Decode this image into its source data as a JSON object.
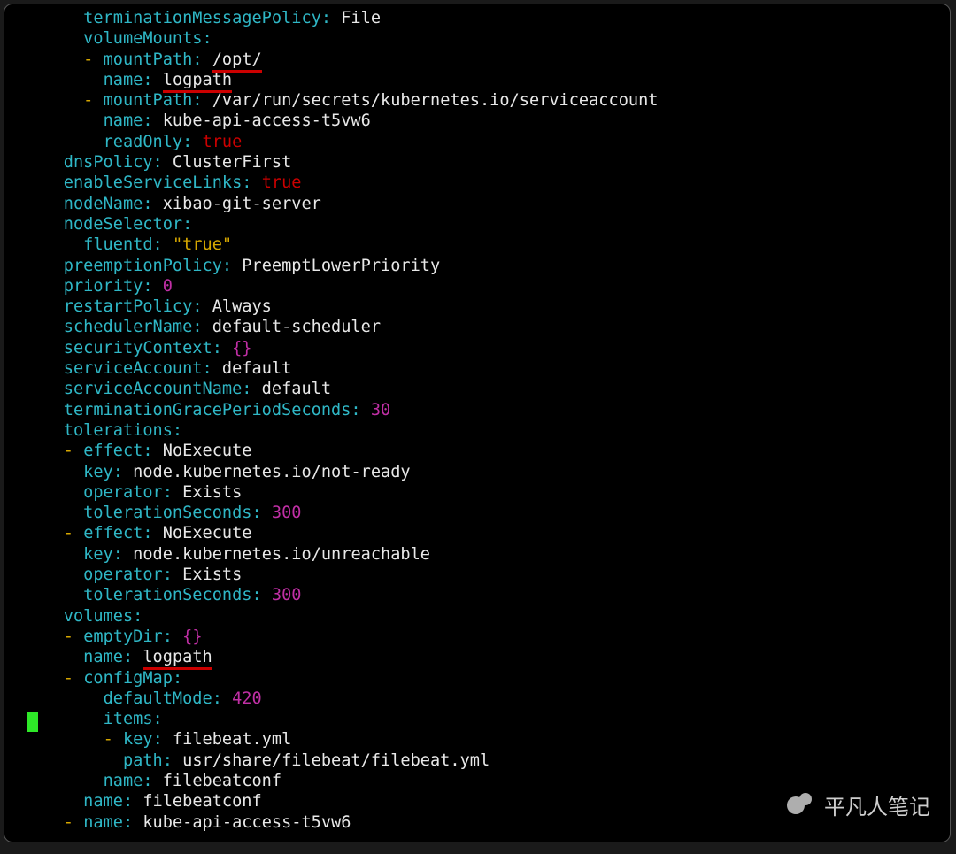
{
  "watermark": "平凡人笔记",
  "lines": [
    {
      "indent": 6,
      "tokens": [
        {
          "c": "k",
          "t": "terminationMessagePolicy"
        },
        {
          "c": "k",
          "t": ":"
        },
        {
          "c": "v",
          "t": " File"
        }
      ]
    },
    {
      "indent": 6,
      "tokens": [
        {
          "c": "k",
          "t": "volumeMounts"
        },
        {
          "c": "k",
          "t": ":"
        }
      ]
    },
    {
      "indent": 6,
      "tokens": [
        {
          "c": "d",
          "t": "-"
        },
        {
          "c": "v",
          "t": " "
        },
        {
          "c": "k",
          "t": "mountPath"
        },
        {
          "c": "k",
          "t": ":"
        },
        {
          "c": "v",
          "t": " "
        },
        {
          "c": "v",
          "t": "/opt/",
          "u": true
        }
      ]
    },
    {
      "indent": 8,
      "tokens": [
        {
          "c": "k",
          "t": "name"
        },
        {
          "c": "k",
          "t": ":"
        },
        {
          "c": "v",
          "t": " "
        },
        {
          "c": "v",
          "t": "logpath",
          "u": true
        }
      ]
    },
    {
      "indent": 6,
      "tokens": [
        {
          "c": "d",
          "t": "-"
        },
        {
          "c": "v",
          "t": " "
        },
        {
          "c": "k",
          "t": "mountPath"
        },
        {
          "c": "k",
          "t": ":"
        },
        {
          "c": "v",
          "t": " /var/run/secrets/kubernetes.io/serviceaccount"
        }
      ]
    },
    {
      "indent": 8,
      "tokens": [
        {
          "c": "k",
          "t": "name"
        },
        {
          "c": "k",
          "t": ":"
        },
        {
          "c": "v",
          "t": " kube-api-access-t5vw6"
        }
      ]
    },
    {
      "indent": 8,
      "tokens": [
        {
          "c": "k",
          "t": "readOnly"
        },
        {
          "c": "k",
          "t": ":"
        },
        {
          "c": "v",
          "t": " "
        },
        {
          "c": "t",
          "t": "true"
        }
      ]
    },
    {
      "indent": 4,
      "tokens": [
        {
          "c": "k",
          "t": "dnsPolicy"
        },
        {
          "c": "k",
          "t": ":"
        },
        {
          "c": "v",
          "t": " ClusterFirst"
        }
      ]
    },
    {
      "indent": 4,
      "tokens": [
        {
          "c": "k",
          "t": "enableServiceLinks"
        },
        {
          "c": "k",
          "t": ":"
        },
        {
          "c": "v",
          "t": " "
        },
        {
          "c": "t",
          "t": "true"
        }
      ]
    },
    {
      "indent": 4,
      "tokens": [
        {
          "c": "k",
          "t": "nodeName"
        },
        {
          "c": "k",
          "t": ":"
        },
        {
          "c": "v",
          "t": " xibao-git-server"
        }
      ]
    },
    {
      "indent": 4,
      "tokens": [
        {
          "c": "k",
          "t": "nodeSelector"
        },
        {
          "c": "k",
          "t": ":"
        }
      ]
    },
    {
      "indent": 6,
      "tokens": [
        {
          "c": "k",
          "t": "fluentd"
        },
        {
          "c": "k",
          "t": ":"
        },
        {
          "c": "v",
          "t": " "
        },
        {
          "c": "s",
          "t": "\"true\""
        }
      ]
    },
    {
      "indent": 4,
      "tokens": [
        {
          "c": "k",
          "t": "preemptionPolicy"
        },
        {
          "c": "k",
          "t": ":"
        },
        {
          "c": "v",
          "t": " PreemptLowerPriority"
        }
      ]
    },
    {
      "indent": 4,
      "tokens": [
        {
          "c": "k",
          "t": "priority"
        },
        {
          "c": "k",
          "t": ":"
        },
        {
          "c": "v",
          "t": " "
        },
        {
          "c": "n",
          "t": "0"
        }
      ]
    },
    {
      "indent": 4,
      "tokens": [
        {
          "c": "k",
          "t": "restartPolicy"
        },
        {
          "c": "k",
          "t": ":"
        },
        {
          "c": "v",
          "t": " Always"
        }
      ]
    },
    {
      "indent": 4,
      "tokens": [
        {
          "c": "k",
          "t": "schedulerName"
        },
        {
          "c": "k",
          "t": ":"
        },
        {
          "c": "v",
          "t": " default-scheduler"
        }
      ]
    },
    {
      "indent": 4,
      "tokens": [
        {
          "c": "k",
          "t": "securityContext"
        },
        {
          "c": "k",
          "t": ":"
        },
        {
          "c": "v",
          "t": " "
        },
        {
          "c": "n",
          "t": "{}"
        }
      ]
    },
    {
      "indent": 4,
      "tokens": [
        {
          "c": "k",
          "t": "serviceAccount"
        },
        {
          "c": "k",
          "t": ":"
        },
        {
          "c": "v",
          "t": " default"
        }
      ]
    },
    {
      "indent": 4,
      "tokens": [
        {
          "c": "k",
          "t": "serviceAccountName"
        },
        {
          "c": "k",
          "t": ":"
        },
        {
          "c": "v",
          "t": " default"
        }
      ]
    },
    {
      "indent": 4,
      "tokens": [
        {
          "c": "k",
          "t": "terminationGracePeriodSeconds"
        },
        {
          "c": "k",
          "t": ":"
        },
        {
          "c": "v",
          "t": " "
        },
        {
          "c": "n",
          "t": "30"
        }
      ]
    },
    {
      "indent": 4,
      "tokens": [
        {
          "c": "k",
          "t": "tolerations"
        },
        {
          "c": "k",
          "t": ":"
        }
      ]
    },
    {
      "indent": 4,
      "tokens": [
        {
          "c": "d",
          "t": "-"
        },
        {
          "c": "v",
          "t": " "
        },
        {
          "c": "k",
          "t": "effect"
        },
        {
          "c": "k",
          "t": ":"
        },
        {
          "c": "v",
          "t": " NoExecute"
        }
      ]
    },
    {
      "indent": 6,
      "tokens": [
        {
          "c": "k",
          "t": "key"
        },
        {
          "c": "k",
          "t": ":"
        },
        {
          "c": "v",
          "t": " node.kubernetes.io/not-ready"
        }
      ]
    },
    {
      "indent": 6,
      "tokens": [
        {
          "c": "k",
          "t": "operator"
        },
        {
          "c": "k",
          "t": ":"
        },
        {
          "c": "v",
          "t": " Exists"
        }
      ]
    },
    {
      "indent": 6,
      "tokens": [
        {
          "c": "k",
          "t": "tolerationSeconds"
        },
        {
          "c": "k",
          "t": ":"
        },
        {
          "c": "v",
          "t": " "
        },
        {
          "c": "n",
          "t": "300"
        }
      ]
    },
    {
      "indent": 4,
      "tokens": [
        {
          "c": "d",
          "t": "-"
        },
        {
          "c": "v",
          "t": " "
        },
        {
          "c": "k",
          "t": "effect"
        },
        {
          "c": "k",
          "t": ":"
        },
        {
          "c": "v",
          "t": " NoExecute"
        }
      ]
    },
    {
      "indent": 6,
      "tokens": [
        {
          "c": "k",
          "t": "key"
        },
        {
          "c": "k",
          "t": ":"
        },
        {
          "c": "v",
          "t": " node.kubernetes.io/unreachable"
        }
      ]
    },
    {
      "indent": 6,
      "tokens": [
        {
          "c": "k",
          "t": "operator"
        },
        {
          "c": "k",
          "t": ":"
        },
        {
          "c": "v",
          "t": " Exists"
        }
      ]
    },
    {
      "indent": 6,
      "tokens": [
        {
          "c": "k",
          "t": "tolerationSeconds"
        },
        {
          "c": "k",
          "t": ":"
        },
        {
          "c": "v",
          "t": " "
        },
        {
          "c": "n",
          "t": "300"
        }
      ]
    },
    {
      "indent": 4,
      "tokens": [
        {
          "c": "k",
          "t": "volumes"
        },
        {
          "c": "k",
          "t": ":"
        }
      ]
    },
    {
      "indent": 4,
      "tokens": [
        {
          "c": "d",
          "t": "-"
        },
        {
          "c": "v",
          "t": " "
        },
        {
          "c": "k",
          "t": "emptyDir"
        },
        {
          "c": "k",
          "t": ":"
        },
        {
          "c": "v",
          "t": " "
        },
        {
          "c": "n",
          "t": "{}"
        }
      ]
    },
    {
      "indent": 6,
      "tokens": [
        {
          "c": "k",
          "t": "name"
        },
        {
          "c": "k",
          "t": ":"
        },
        {
          "c": "v",
          "t": " "
        },
        {
          "c": "v",
          "t": "logpath",
          "u": true
        }
      ]
    },
    {
      "indent": 4,
      "tokens": [
        {
          "c": "d",
          "t": "-"
        },
        {
          "c": "v",
          "t": " "
        },
        {
          "c": "k",
          "t": "configMap"
        },
        {
          "c": "k",
          "t": ":"
        }
      ]
    },
    {
      "indent": 8,
      "tokens": [
        {
          "c": "k",
          "t": "defaultMode"
        },
        {
          "c": "k",
          "t": ":"
        },
        {
          "c": "v",
          "t": " "
        },
        {
          "c": "n",
          "t": "420"
        }
      ]
    },
    {
      "indent": 8,
      "tokens": [
        {
          "c": "k",
          "t": "items"
        },
        {
          "c": "k",
          "t": ":"
        }
      ]
    },
    {
      "indent": 8,
      "tokens": [
        {
          "c": "d",
          "t": "-"
        },
        {
          "c": "v",
          "t": " "
        },
        {
          "c": "k",
          "t": "key"
        },
        {
          "c": "k",
          "t": ":"
        },
        {
          "c": "v",
          "t": " filebeat.yml"
        }
      ]
    },
    {
      "indent": 10,
      "tokens": [
        {
          "c": "k",
          "t": "path"
        },
        {
          "c": "k",
          "t": ":"
        },
        {
          "c": "v",
          "t": " usr/share/filebeat/filebeat.yml"
        }
      ]
    },
    {
      "indent": 8,
      "tokens": [
        {
          "c": "k",
          "t": "name"
        },
        {
          "c": "k",
          "t": ":"
        },
        {
          "c": "v",
          "t": " filebeatconf"
        }
      ]
    },
    {
      "indent": 6,
      "tokens": [
        {
          "c": "k",
          "t": "name"
        },
        {
          "c": "k",
          "t": ":"
        },
        {
          "c": "v",
          "t": " filebeatconf"
        }
      ]
    },
    {
      "indent": 4,
      "tokens": [
        {
          "c": "d",
          "t": "-"
        },
        {
          "c": "v",
          "t": " "
        },
        {
          "c": "k",
          "t": "name"
        },
        {
          "c": "k",
          "t": ":"
        },
        {
          "c": "v",
          "t": " kube-api-access-t5vw6"
        }
      ]
    }
  ]
}
